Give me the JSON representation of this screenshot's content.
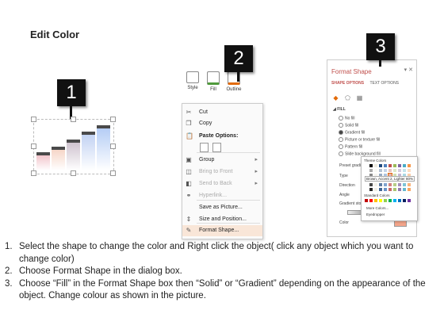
{
  "title": "Edit Color",
  "badges": [
    "1",
    "2",
    "3"
  ],
  "colors": {
    "badge": "#111111",
    "menu_highlight": "#f9e6d8",
    "format_title": "#c0504d",
    "bar_colors": [
      "#f2c6cc",
      "#f6d6c8",
      "#cfc3cf",
      "#c3d3f3",
      "#b5cdf5"
    ]
  },
  "ribbon": {
    "items": [
      {
        "label": "Style",
        "icon": "style-brush-icon"
      },
      {
        "label": "Fill",
        "icon": "fill-bucket-icon"
      },
      {
        "label": "Outline",
        "icon": "outline-pen-icon"
      }
    ]
  },
  "context_menu": {
    "items": [
      {
        "label": "Cut",
        "icon": "scissors-icon",
        "glyph": "✂",
        "disabled": false
      },
      {
        "label": "Copy",
        "icon": "copy-icon",
        "glyph": "❐",
        "disabled": false
      },
      {
        "label": "Paste Options:",
        "icon": "clipboard-icon",
        "glyph": "📋",
        "disabled": false,
        "bold": true
      },
      {
        "label": "Group",
        "icon": "group-icon",
        "glyph": "▣",
        "disabled": false,
        "submenu": true
      },
      {
        "label": "Bring to Front",
        "icon": "bring-front-icon",
        "glyph": "◫",
        "disabled": true,
        "submenu": true
      },
      {
        "label": "Send to Back",
        "icon": "send-back-icon",
        "glyph": "◧",
        "disabled": true,
        "submenu": true
      },
      {
        "label": "Hyperlink...",
        "icon": "hyperlink-icon",
        "glyph": "⚭",
        "disabled": true
      },
      {
        "label": "Save as Picture...",
        "icon": "save-picture-icon",
        "glyph": "",
        "disabled": false
      },
      {
        "label": "Size and Position...",
        "icon": "size-position-icon",
        "glyph": "⇕",
        "disabled": false
      },
      {
        "label": "Format Shape...",
        "icon": "format-shape-icon",
        "glyph": "✎",
        "disabled": false,
        "highlighted": true
      }
    ]
  },
  "format_shape": {
    "title": "Format Shape",
    "close": "▾ ✕",
    "tabs": [
      "SHAPE OPTIONS",
      "TEXT OPTIONS"
    ],
    "section": "◢ FILL",
    "fill_options": [
      {
        "label": "No fill",
        "selected": false
      },
      {
        "label": "Solid fill",
        "selected": false
      },
      {
        "label": "Gradient fill",
        "selected": true
      },
      {
        "label": "Picture or texture fill",
        "selected": false
      },
      {
        "label": "Pattern fill",
        "selected": false
      },
      {
        "label": "Slide background fill",
        "selected": false
      }
    ],
    "labels": [
      "Preset gradi",
      "Type",
      "Direction",
      "Angle",
      "Gradient stops",
      "Color"
    ]
  },
  "palette": {
    "theme_header": "Theme Colors",
    "standard_header": "Standard Colors",
    "tooltip": "Brown, Accent 2, Lighter 80%",
    "more_colors": "More Colors...",
    "eyedropper": "Eyedropper",
    "theme_colors": [
      "#ffffff",
      "#000000",
      "#eeece1",
      "#1f497d",
      "#4f81bd",
      "#c0504d",
      "#9bbb59",
      "#8064a2",
      "#4bacc6",
      "#f79646"
    ],
    "standard_colors": [
      "#c00000",
      "#ff0000",
      "#ffc000",
      "#ffff00",
      "#92d050",
      "#00b050",
      "#00b0f0",
      "#0070c0",
      "#002060",
      "#7030a0"
    ]
  },
  "chart_bars": [
    0.32,
    0.45,
    0.6,
    0.78,
    0.92
  ],
  "steps": [
    {
      "num": "1.",
      "text": "Select the shape to change the color and Right click the object( click any object which you want to change color)"
    },
    {
      "num": "2.",
      "text": "Choose Format Shape in the dialog box."
    },
    {
      "num": "3.",
      "text": "Choose “Fill” in the Format Shape box then “Solid” or “Gradient” depending on the appearance of the object. Change colour as shown in the picture."
    }
  ]
}
